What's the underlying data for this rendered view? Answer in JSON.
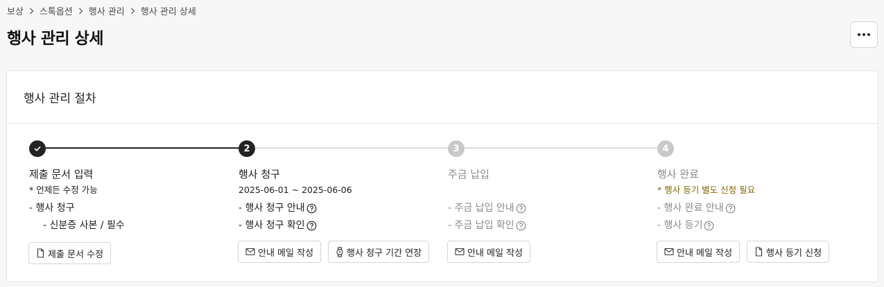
{
  "breadcrumb": [
    "보상",
    "스톡옵션",
    "행사 관리",
    "행사 관리 상세"
  ],
  "page": {
    "title": "행사 관리 상세"
  },
  "card": {
    "title": "행사 관리 절차"
  },
  "steps": [
    {
      "marker": "",
      "status": "done",
      "title": "제출 문서 입력",
      "note": "* 언제든 수정 가능",
      "items": [
        "- 행사 청구",
        "- 신분증 사본 / 필수"
      ],
      "buttons": [
        {
          "icon": "document-icon",
          "label": "제출 문서 수정"
        }
      ]
    },
    {
      "marker": "2",
      "status": "active",
      "title": "행사 청구",
      "note": "2025-06-01 ~ 2025-06-06",
      "items": [
        "- 행사 청구 안내",
        "- 행사 청구 확인"
      ],
      "buttons": [
        {
          "icon": "mail-icon",
          "label": "안내 메일 작성"
        },
        {
          "icon": "watch-icon",
          "label": "행사 청구 기간 연장"
        }
      ]
    },
    {
      "marker": "3",
      "status": "pending",
      "title": "주금 납입",
      "note": "",
      "items": [
        "- 주금 납입 안내",
        "- 주금 납입 확인"
      ],
      "buttons": [
        {
          "icon": "mail-icon",
          "label": "안내 메일 작성"
        }
      ]
    },
    {
      "marker": "4",
      "status": "pending",
      "title": "행사 완료",
      "note": "* 행사 등기 별도 신청 필요",
      "items": [
        "- 행사 완료 안내",
        "- 행사 등기"
      ],
      "buttons": [
        {
          "icon": "mail-icon",
          "label": "안내 메일 작성"
        },
        {
          "icon": "document-icon",
          "label": "행사 등기 신청"
        }
      ]
    }
  ],
  "colors": {
    "active": "#232323",
    "pending": "#c9c9c9",
    "warning_note": "#806600"
  }
}
